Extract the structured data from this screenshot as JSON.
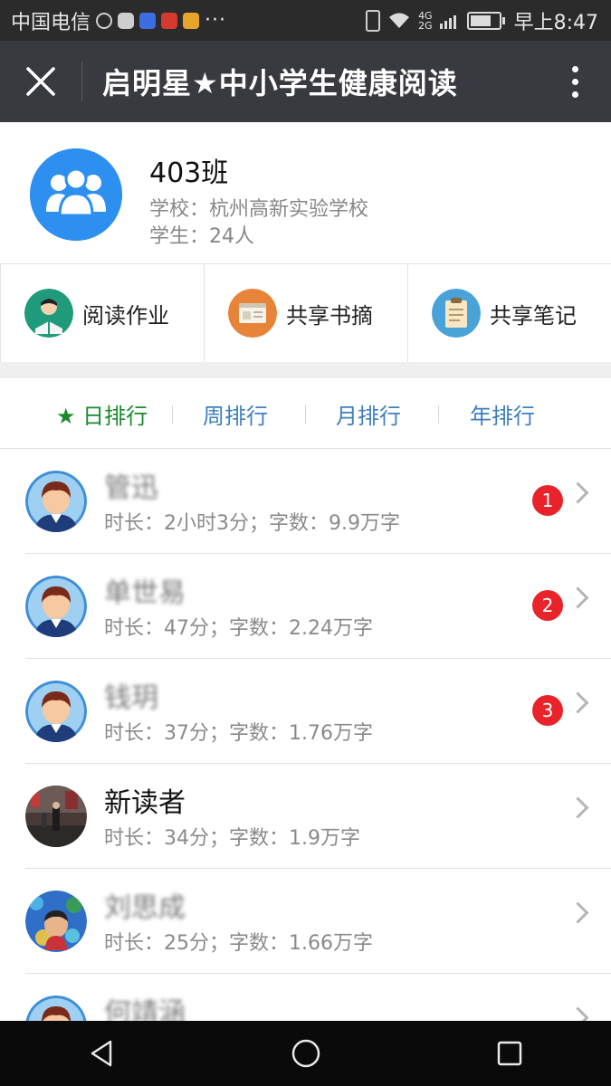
{
  "status_bar": {
    "carrier": "中国电信",
    "extra_dots": "···",
    "network_top": "4G",
    "network_bottom": "2G",
    "time": "早上8:47"
  },
  "title_bar": {
    "title": "启明星★中小学生健康阅读"
  },
  "class_info": {
    "name": "403班",
    "school": "学校：杭州高新实验学校",
    "students": "学生：24人"
  },
  "shortcuts": [
    {
      "label": "阅读作业",
      "icon": "reading-homework-icon",
      "color": "#1f9a7a"
    },
    {
      "label": "共享书摘",
      "icon": "book-excerpt-icon",
      "color": "#e8833a"
    },
    {
      "label": "共享笔记",
      "icon": "notes-icon",
      "color": "#4aa3d8"
    }
  ],
  "ranking_tabs": [
    {
      "label": "★ 日排行",
      "active": true
    },
    {
      "label": "周排行",
      "active": false
    },
    {
      "label": "月排行",
      "active": false
    },
    {
      "label": "年排行",
      "active": false
    }
  ],
  "leaderboard": [
    {
      "name": "管迅",
      "stats": "时长：2小时3分；字数：9.9万字",
      "rank": "1",
      "avatar": "cartoon-boy"
    },
    {
      "name": "单世易",
      "stats": "时长：47分；字数：2.24万字",
      "rank": "2",
      "avatar": "cartoon-boy"
    },
    {
      "name": "钱玥",
      "stats": "时长：37分；字数：1.76万字",
      "rank": "3",
      "avatar": "cartoon-boy"
    },
    {
      "name": "新读者",
      "stats": "时长：34分；字数：1.9万字",
      "rank": "",
      "avatar": "photo-street"
    },
    {
      "name": "刘思成",
      "stats": "时长：25分；字数：1.66万字",
      "rank": "",
      "avatar": "photo-child"
    },
    {
      "name": "何靖涵",
      "stats": "",
      "rank": "",
      "avatar": "cartoon-boy"
    }
  ],
  "colors": {
    "title_bar_bg": "#393a3f",
    "active_tab": "#1a8a2b",
    "inactive_tab": "#3d7fc1",
    "rank_badge": "#e8232a",
    "class_avatar": "#2d8ff0"
  }
}
